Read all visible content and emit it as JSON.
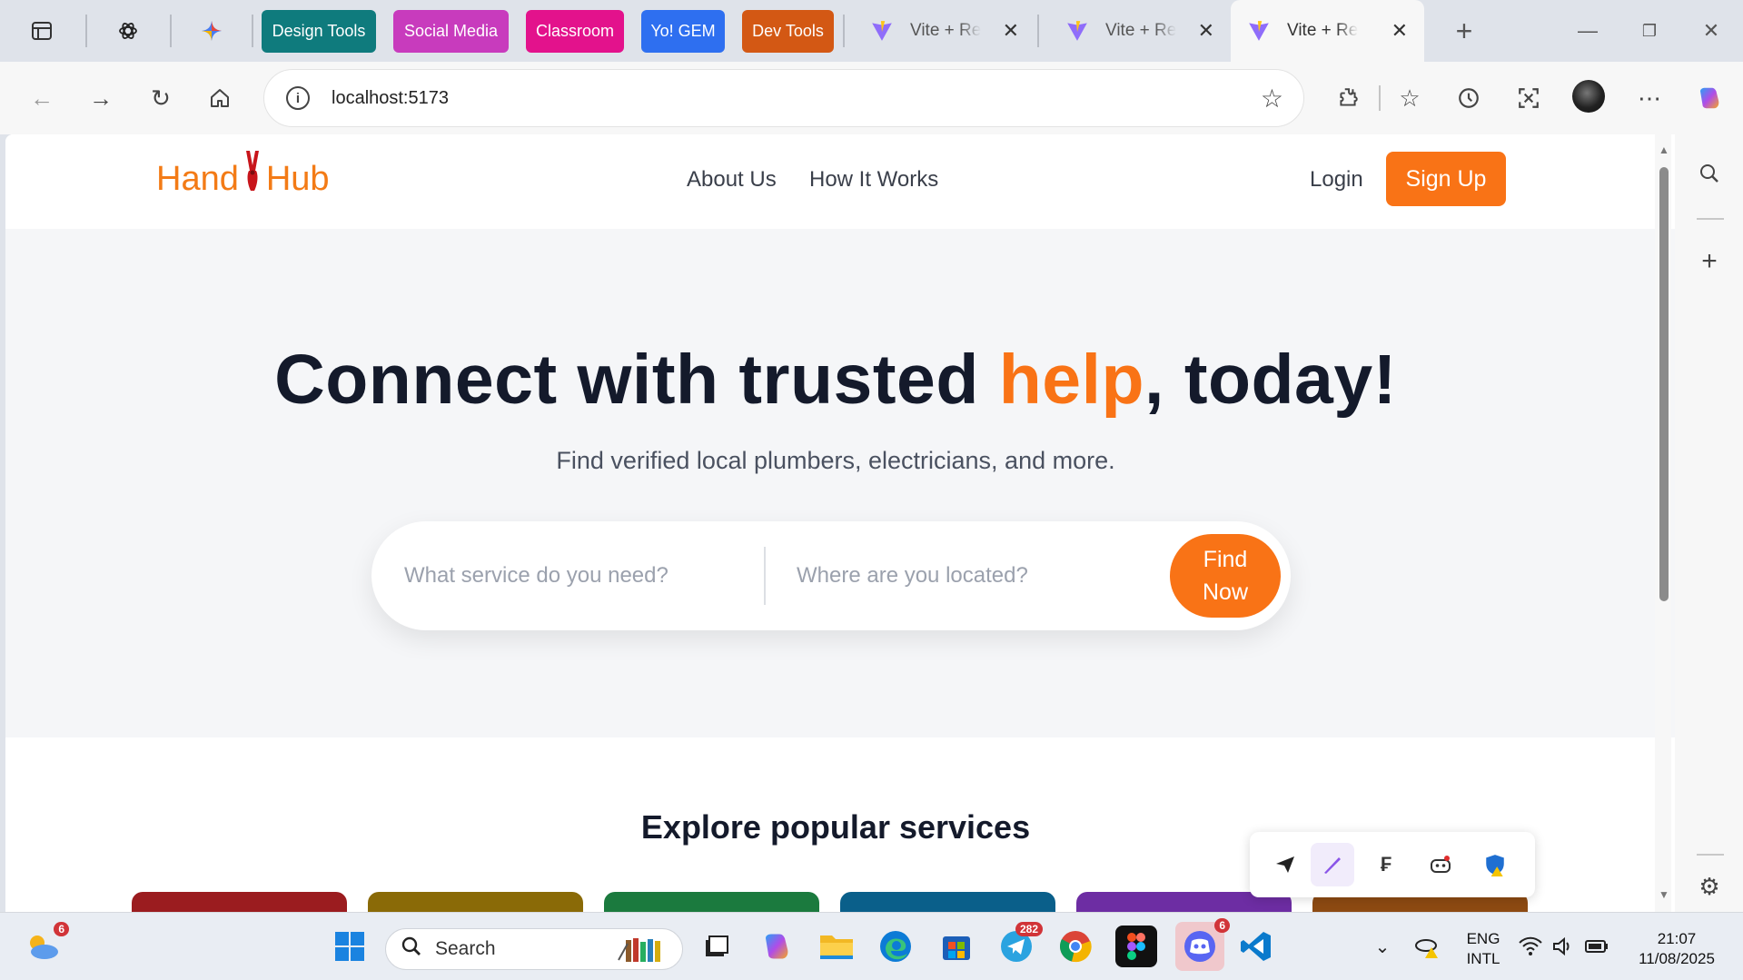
{
  "browser": {
    "tab_groups": [
      {
        "label": "Design Tools",
        "color": "#0f7b7d"
      },
      {
        "label": "Social Media",
        "color": "#c83bbd"
      },
      {
        "label": "Classroom",
        "color": "#e3128c"
      },
      {
        "label": "Yo! GEM",
        "color": "#2e6ff0"
      },
      {
        "label": "Dev Tools",
        "color": "#d35814"
      }
    ],
    "tabs": [
      {
        "title": "Vite + React"
      },
      {
        "title": "Vite + React"
      },
      {
        "title": "Vite + React",
        "active": true
      }
    ],
    "address": "localhost:5173"
  },
  "site": {
    "logo_left": "Hand",
    "logo_right": "Hub",
    "nav": {
      "about": "About Us",
      "how": "How It Works",
      "login": "Login",
      "signup": "Sign Up"
    },
    "hero": {
      "title_part1": "Connect with trusted ",
      "title_accent": "help",
      "title_part2": ", today!",
      "subtitle": "Find verified local plumbers, electricians, and more.",
      "service_placeholder": "What service do you need?",
      "location_placeholder": "Where are you located?",
      "find_line1": "Find",
      "find_line2": "Now"
    },
    "explore_title": "Explore popular services",
    "card_colors": [
      "#9b1c1f",
      "#8a6a07",
      "#1b7a3e",
      "#0a5f8a",
      "#6d2da3",
      "#8d4a12"
    ],
    "accent": "#f97316"
  },
  "taskbar": {
    "weather_badge": "6",
    "search_label": "Search",
    "telegram_badge": "282",
    "discord_badge": "6",
    "lang1": "ENG",
    "lang2": "INTL",
    "time": "21:07",
    "date": "11/08/2025"
  }
}
